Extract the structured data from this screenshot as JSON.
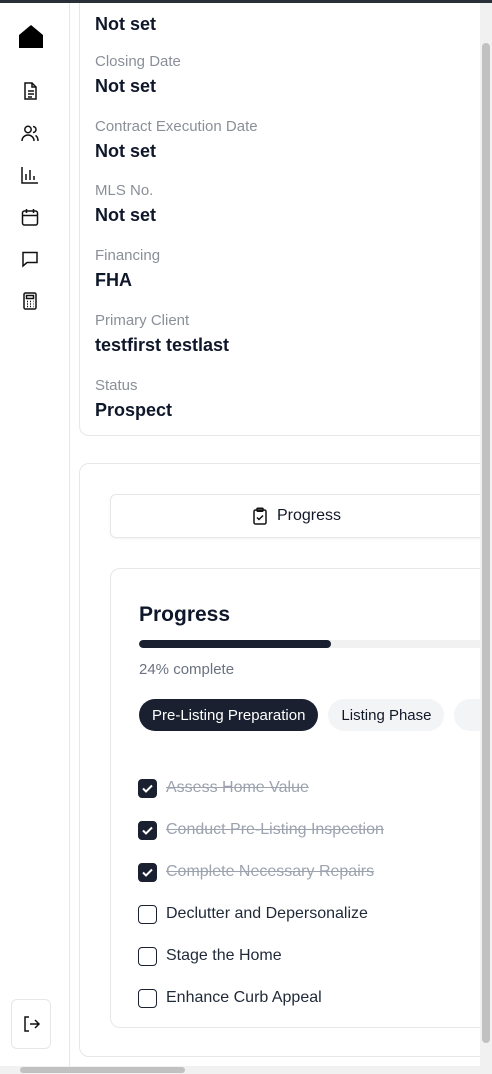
{
  "sidebar": {
    "logo_icon": "house-icon",
    "nav": [
      {
        "icon": "document-icon"
      },
      {
        "icon": "users-icon"
      },
      {
        "icon": "bar-chart-icon"
      },
      {
        "icon": "calendar-icon"
      },
      {
        "icon": "message-icon"
      },
      {
        "icon": "calculator-icon"
      }
    ],
    "logout_icon": "logout-icon"
  },
  "details": {
    "fields": [
      {
        "label": "",
        "value": "Not set"
      },
      {
        "label": "Closing Date",
        "value": "Not set"
      },
      {
        "label": "Contract Execution Date",
        "value": "Not set"
      },
      {
        "label": "MLS No.",
        "value": "Not set"
      },
      {
        "label": "Financing",
        "value": "FHA"
      },
      {
        "label": "Primary Client",
        "value": "testfirst testlast"
      },
      {
        "label": "Status",
        "value": "Prospect"
      }
    ]
  },
  "tabs": {
    "active_label": "Progress",
    "active_icon": "clipboard-check-icon"
  },
  "progress": {
    "title": "Progress",
    "percent": 24,
    "percent_text": "24% complete",
    "phases": [
      {
        "label": "Pre-Listing Preparation",
        "active": true
      },
      {
        "label": "Listing Phase",
        "active": false
      }
    ],
    "tasks": [
      {
        "label": "Assess Home Value",
        "done": true
      },
      {
        "label": "Conduct Pre-Listing Inspection",
        "done": true
      },
      {
        "label": "Complete Necessary Repairs",
        "done": true
      },
      {
        "label": "Declutter and Depersonalize",
        "done": false
      },
      {
        "label": "Stage the Home",
        "done": false
      },
      {
        "label": "Enhance Curb Appeal",
        "done": false
      }
    ]
  },
  "colors": {
    "accent": "#1a2030",
    "muted_text": "#8a8f98",
    "border": "#e5e7eb"
  }
}
